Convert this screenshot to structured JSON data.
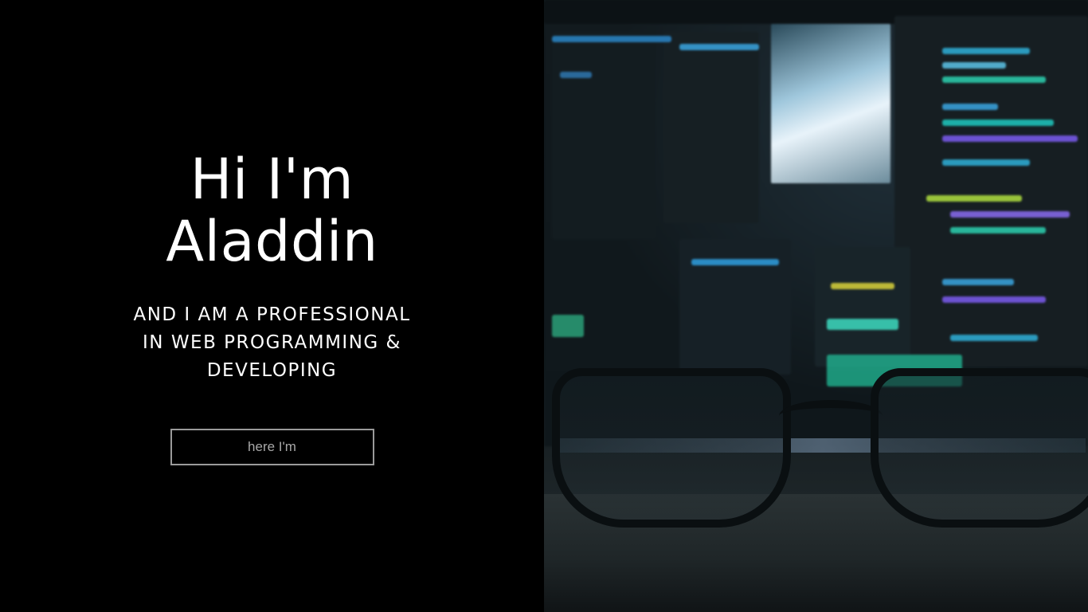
{
  "hero": {
    "headline_line1": "Hi I'm",
    "headline_line2": "Aladdin",
    "subtitle_line1": "AND I AM A PROFESSIONAL",
    "subtitle_line2": "IN WEB PROGRAMMING &",
    "subtitle_line3": "DEVELOPING",
    "cta_label": "here I'm"
  },
  "colors": {
    "background": "#000000",
    "text": "#ffffff",
    "button_border": "#9a9a9a",
    "button_text": "#a8a8a8"
  }
}
